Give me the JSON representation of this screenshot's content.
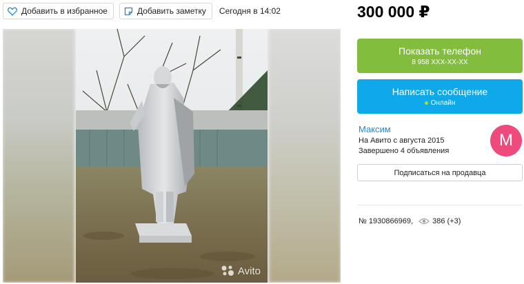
{
  "toolbar": {
    "favorite_label": "Добавить в избранное",
    "note_label": "Добавить заметку",
    "date": "Сегодня в 14:02"
  },
  "listing": {
    "price": "300 000 ₽",
    "watermark": "Avito"
  },
  "actions": {
    "phone_label": "Показать телефон",
    "phone_number": "8 958 XXX-XX-XX",
    "message_label": "Написать сообщение",
    "online_status": "Онлайн"
  },
  "seller": {
    "name": "Максим",
    "since": "На Авито с августа 2015",
    "completed": "Завершено 4 объявления",
    "avatar_letter": "М",
    "subscribe_label": "Подписаться на продавца"
  },
  "meta": {
    "ad_number": "№ 1930866969,",
    "views": "386 (+3)"
  },
  "colors": {
    "phone_button": "#83bd3e",
    "message_button": "#0fa8e8",
    "seller_link": "#1b8ad8",
    "avatar_bg": "#ef4a7c",
    "online_dot": "#9be23c"
  }
}
